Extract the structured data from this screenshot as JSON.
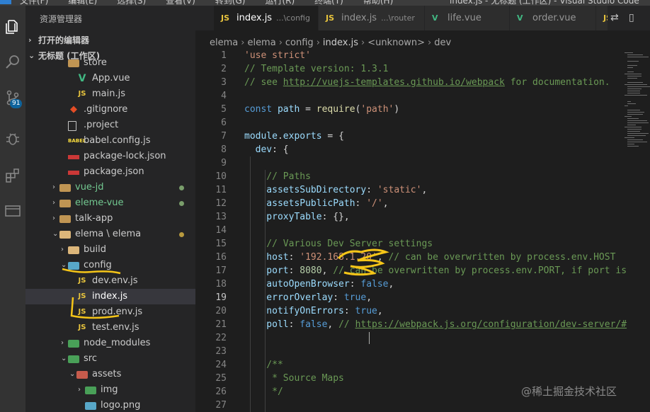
{
  "window": {
    "menu": [
      "文件(F)",
      "编辑(E)",
      "选择(S)",
      "查看(V)",
      "转到(G)",
      "运行(R)",
      "终端(T)",
      "帮助(H)"
    ],
    "title": "index.js - 无标题 (工作区) - Visual Studio Code"
  },
  "activity": {
    "scm_badge": "91",
    "icons": [
      "explorer-icon",
      "search-icon",
      "source-control-icon",
      "debug-icon",
      "extensions-icon",
      "remote-explorer-icon"
    ]
  },
  "sidebar": {
    "title": "资源管理器",
    "open_editors": "打开的编辑器",
    "workspace": "无标题 (工作区)",
    "items": [
      {
        "label": "store",
        "icon": "folder",
        "indent": 2
      },
      {
        "label": "App.vue",
        "icon": "vue",
        "indent": 3
      },
      {
        "label": "main.js",
        "icon": "js",
        "indent": 3
      },
      {
        "label": ".gitignore",
        "icon": "git",
        "indent": 2
      },
      {
        "label": ".project",
        "icon": "file",
        "indent": 2
      },
      {
        "label": "babel.config.js",
        "icon": "babel",
        "indent": 2
      },
      {
        "label": "package-lock.json",
        "icon": "npm",
        "indent": 2
      },
      {
        "label": "package.json",
        "icon": "npm",
        "indent": 2
      },
      {
        "label": "vue-jd",
        "icon": "folder",
        "indent": 1,
        "chev": "›",
        "dot": "#7a9e6b"
      },
      {
        "label": "eleme-vue",
        "icon": "folder",
        "indent": 1,
        "chev": "›",
        "dot": "#7a9e6b"
      },
      {
        "label": "talk-app",
        "icon": "folder",
        "indent": 1,
        "chev": "›"
      },
      {
        "label": "elema \\ elema",
        "icon": "folder-open",
        "indent": 1,
        "chev": "⌄",
        "dot": "#b89a3e"
      },
      {
        "label": "build",
        "icon": "folder-open",
        "indent": 2,
        "chev": "›"
      },
      {
        "label": "config",
        "icon": "folder-blue",
        "indent": 2,
        "chev": "⌄"
      },
      {
        "label": "dev.env.js",
        "icon": "js",
        "indent": 3
      },
      {
        "label": "index.js",
        "icon": "js",
        "indent": 3,
        "selected": true
      },
      {
        "label": "prod.env.js",
        "icon": "js",
        "indent": 3
      },
      {
        "label": "test.env.js",
        "icon": "js",
        "indent": 3
      },
      {
        "label": "node_modules",
        "icon": "folder-green",
        "indent": 2,
        "chev": "›"
      },
      {
        "label": "src",
        "icon": "folder-green",
        "indent": 2,
        "chev": "⌄"
      },
      {
        "label": "assets",
        "icon": "folder-red",
        "indent": 3,
        "chev": "⌄"
      },
      {
        "label": "img",
        "icon": "folder-green",
        "indent": 4,
        "chev": "›"
      },
      {
        "label": "logo.png",
        "icon": "image",
        "indent": 4
      }
    ]
  },
  "tabs": [
    {
      "label": "index.js",
      "desc": "...\\config",
      "icon": "JS",
      "active": true
    },
    {
      "label": "index.js",
      "desc": "...\\router",
      "icon": "JS"
    },
    {
      "label": "life.vue",
      "icon": "V"
    },
    {
      "label": "order.vue",
      "icon": "V"
    },
    {
      "label": "",
      "icon": "JS"
    }
  ],
  "breadcrumbs": [
    "elema",
    "elema",
    "config",
    "index.js",
    "<unknown>",
    "dev"
  ],
  "code": {
    "lines": [
      {
        "n": "1",
        "t": [
          [
            "str",
            "'use strict'"
          ]
        ]
      },
      {
        "n": "2",
        "t": [
          [
            "com",
            "// Template version: 1.3.1"
          ]
        ]
      },
      {
        "n": "3",
        "t": [
          [
            "com",
            "// see "
          ],
          [
            "link",
            "http://vuejs-templates.github.io/webpack"
          ],
          [
            "com",
            " for documentation."
          ]
        ]
      },
      {
        "n": "4",
        "t": []
      },
      {
        "n": "5",
        "t": [
          [
            "kw",
            "const "
          ],
          [
            "var",
            "path"
          ],
          [
            "plain",
            " = "
          ],
          [
            "fn",
            "require"
          ],
          [
            "plain",
            "("
          ],
          [
            "str",
            "'path'"
          ],
          [
            "plain",
            ")"
          ]
        ]
      },
      {
        "n": "6",
        "t": []
      },
      {
        "n": "7",
        "t": [
          [
            "var",
            "module"
          ],
          [
            "plain",
            "."
          ],
          [
            "var",
            "exports"
          ],
          [
            "plain",
            " = {"
          ]
        ]
      },
      {
        "n": "8",
        "t": [
          [
            "var",
            "  dev"
          ],
          [
            "plain",
            ": {"
          ]
        ]
      },
      {
        "n": "9",
        "t": []
      },
      {
        "n": "10",
        "t": [
          [
            "com",
            "    // Paths"
          ]
        ]
      },
      {
        "n": "11",
        "t": [
          [
            "var",
            "    assetsSubDirectory"
          ],
          [
            "plain",
            ": "
          ],
          [
            "str",
            "'static'"
          ],
          [
            "plain",
            ","
          ]
        ]
      },
      {
        "n": "12",
        "t": [
          [
            "var",
            "    assetsPublicPath"
          ],
          [
            "plain",
            ": "
          ],
          [
            "str",
            "'/'"
          ],
          [
            "plain",
            ","
          ]
        ]
      },
      {
        "n": "13",
        "t": [
          [
            "var",
            "    proxyTable"
          ],
          [
            "plain",
            ": {},"
          ]
        ]
      },
      {
        "n": "14",
        "t": []
      },
      {
        "n": "15",
        "t": [
          [
            "com",
            "    // Various Dev Server settings"
          ]
        ]
      },
      {
        "n": "16",
        "t": [
          [
            "var",
            "    host"
          ],
          [
            "plain",
            ": "
          ],
          [
            "str",
            "'192.168.1.20'"
          ],
          [
            "plain",
            ", "
          ],
          [
            "com",
            "// can be overwritten by process.env.HOST"
          ]
        ]
      },
      {
        "n": "17",
        "t": [
          [
            "var",
            "    port"
          ],
          [
            "plain",
            ": "
          ],
          [
            "num",
            "8080"
          ],
          [
            "plain",
            ", "
          ],
          [
            "com",
            "// can be overwritten by process.env.PORT, if port is"
          ]
        ]
      },
      {
        "n": "18",
        "t": [
          [
            "var",
            "    autoOpenBrowser"
          ],
          [
            "plain",
            ": "
          ],
          [
            "kw",
            "false"
          ],
          [
            "plain",
            ","
          ]
        ]
      },
      {
        "n": "19",
        "t": [
          [
            "var",
            "    errorOverlay"
          ],
          [
            "plain",
            ": "
          ],
          [
            "kw",
            "true"
          ],
          [
            "plain",
            ","
          ]
        ]
      },
      {
        "n": "20",
        "t": [
          [
            "var",
            "    notifyOnErrors"
          ],
          [
            "plain",
            ": "
          ],
          [
            "kw",
            "true"
          ],
          [
            "plain",
            ","
          ]
        ]
      },
      {
        "n": "21",
        "t": [
          [
            "var",
            "    poll"
          ],
          [
            "plain",
            ": "
          ],
          [
            "kw",
            "false"
          ],
          [
            "plain",
            ", "
          ],
          [
            "com",
            "// "
          ],
          [
            "link",
            "https://webpack.js.org/configuration/dev-server/#"
          ]
        ]
      },
      {
        "n": "22",
        "t": []
      },
      {
        "n": "23",
        "t": []
      },
      {
        "n": "24",
        "t": [
          [
            "com",
            "    /**"
          ]
        ]
      },
      {
        "n": "25",
        "t": [
          [
            "com",
            "     * Source Maps"
          ]
        ]
      },
      {
        "n": "26",
        "t": [
          [
            "com",
            "     */"
          ]
        ]
      },
      {
        "n": "27",
        "t": []
      }
    ]
  },
  "watermark": "@稀土掘金技术社区",
  "colors": {
    "accent": "#007acc",
    "annotation": "#f5c518"
  }
}
